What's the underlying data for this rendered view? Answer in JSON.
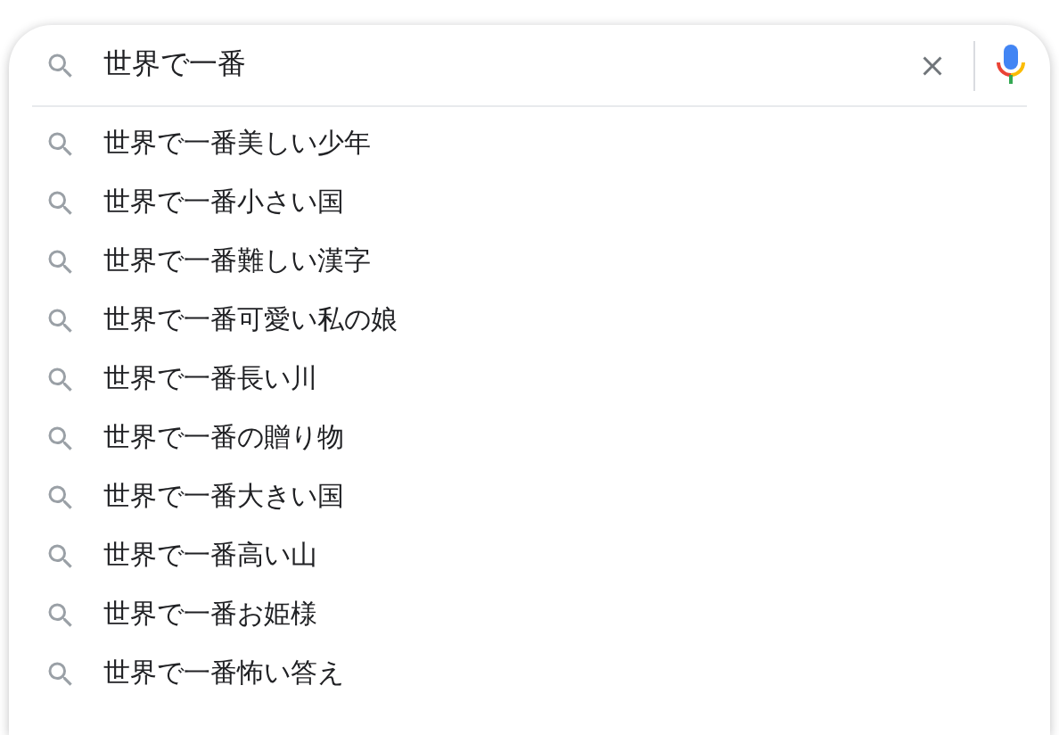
{
  "search": {
    "value": "世界で一番"
  },
  "suggestions": [
    {
      "text": "世界で一番美しい少年"
    },
    {
      "text": "世界で一番小さい国"
    },
    {
      "text": "世界で一番難しい漢字"
    },
    {
      "text": "世界で一番可愛い私の娘"
    },
    {
      "text": "世界で一番長い川"
    },
    {
      "text": "世界で一番の贈り物"
    },
    {
      "text": "世界で一番大きい国"
    },
    {
      "text": "世界で一番高い山"
    },
    {
      "text": "世界で一番お姫様"
    },
    {
      "text": "世界で一番怖い答え"
    }
  ]
}
